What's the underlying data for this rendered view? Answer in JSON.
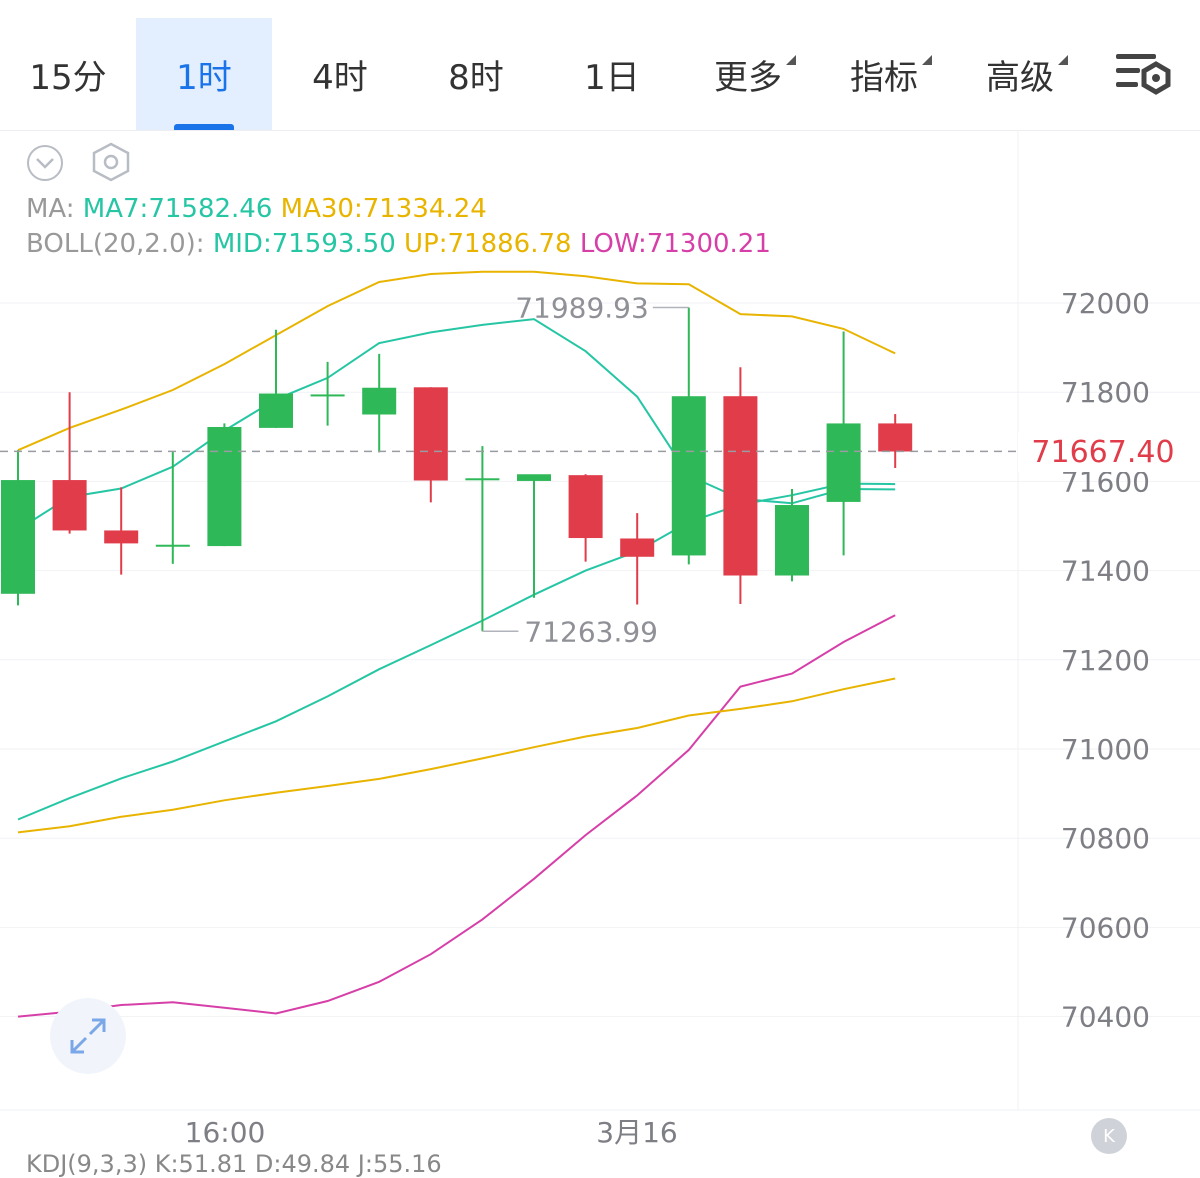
{
  "tabs": [
    {
      "label": "15分",
      "active": false,
      "dropdown": false
    },
    {
      "label": "1时",
      "active": true,
      "dropdown": false
    },
    {
      "label": "4时",
      "active": false,
      "dropdown": false
    },
    {
      "label": "8时",
      "active": false,
      "dropdown": false
    },
    {
      "label": "1日",
      "active": false,
      "dropdown": false
    },
    {
      "label": "更多",
      "active": false,
      "dropdown": true
    },
    {
      "label": "指标",
      "active": false,
      "dropdown": true
    },
    {
      "label": "高级",
      "active": false,
      "dropdown": true
    }
  ],
  "icons": {
    "settings": "chart-settings-icon",
    "collapse_toggle": "chevron-down-circle-icon",
    "indicator_settings": "hexagon-settings-icon",
    "expand": "expand-arrows-icon",
    "side_collapse": "collapse-k-icon"
  },
  "legend": {
    "ma_prefix": "MA:",
    "ma7": "MA7:71582.46",
    "ma30": "MA30:71334.24",
    "boll_prefix": "BOLL(20,2.0):",
    "mid": "MID:71593.50",
    "up": "UP:71886.78",
    "low": "LOW:71300.21"
  },
  "colors": {
    "up": "#2eb857",
    "down": "#e03c4a",
    "ma7": "#26c6a5",
    "ma30": "#e8b400",
    "boll_up": "#e8b400",
    "boll_mid": "#26c6a5",
    "boll_low": "#d63fa8",
    "accent": "#1a73e8"
  },
  "current_price": "71667.40",
  "high_marker": "71989.93",
  "low_marker": "71263.99",
  "kdj_text": "KDJ(9,3,3)  K:51.81  D:49.84  J:55.16",
  "collapse_glyph": "K",
  "chart_data": {
    "type": "candlestick",
    "y_ticks": [
      "72000",
      "71800",
      "71600",
      "71400",
      "71200",
      "71000",
      "70800",
      "70600",
      "70400"
    ],
    "x_ticks": [
      "16:00",
      "3月16"
    ],
    "candles": [
      {
        "o": 71348,
        "h": 71670,
        "l": 71322,
        "c": 71603
      },
      {
        "o": 71603,
        "h": 71800,
        "l": 71483,
        "c": 71490
      },
      {
        "o": 71490,
        "h": 71587,
        "l": 71391,
        "c": 71461
      },
      {
        "o": 71458,
        "h": 71668,
        "l": 71415,
        "c": 71458
      },
      {
        "o": 71455,
        "h": 71730,
        "l": 71455,
        "c": 71722
      },
      {
        "o": 71720,
        "h": 71940,
        "l": 71720,
        "c": 71797
      },
      {
        "o": 71795,
        "h": 71868,
        "l": 71725,
        "c": 71795
      },
      {
        "o": 71750,
        "h": 71886,
        "l": 71665,
        "c": 71810
      },
      {
        "o": 71811,
        "h": 71811,
        "l": 71553,
        "c": 71602
      },
      {
        "o": 71607,
        "h": 71679,
        "l": 71264,
        "c": 71607
      },
      {
        "o": 71601,
        "h": 71611,
        "l": 71339,
        "c": 71616
      },
      {
        "o": 71614,
        "h": 71616,
        "l": 71420,
        "c": 71473
      },
      {
        "o": 71472,
        "h": 71529,
        "l": 71324,
        "c": 71431
      },
      {
        "o": 71434,
        "h": 71990,
        "l": 71414,
        "c": 71791
      },
      {
        "o": 71791,
        "h": 71856,
        "l": 71325,
        "c": 71389
      },
      {
        "o": 71389,
        "h": 71583,
        "l": 71376,
        "c": 71547
      },
      {
        "o": 71554,
        "h": 71936,
        "l": 71434,
        "c": 71730
      },
      {
        "o": 71730,
        "h": 71751,
        "l": 71630,
        "c": 71667
      }
    ],
    "boll_up": [
      71670,
      71720,
      71761,
      71805,
      71863,
      71928,
      71993,
      72047,
      72065,
      72070,
      72070,
      72060,
      72044,
      72042,
      71975,
      71970,
      71942,
      71887
    ],
    "boll_mid": [
      70842,
      70890,
      70934,
      70972,
      71017,
      71062,
      71118,
      71179,
      71233,
      71288,
      71346,
      71400,
      71443,
      71509,
      71548,
      71569,
      71595,
      71594
    ],
    "boll_low": [
      70400,
      70411,
      70426,
      70432,
      70420,
      70407,
      70435,
      70478,
      70540,
      70618,
      70709,
      70807,
      70896,
      70998,
      71140,
      71169,
      71240,
      71300
    ],
    "ma7": [
      71492,
      71565,
      71584,
      71633,
      71714,
      71784,
      71832,
      71910,
      71934,
      71951,
      71964,
      71892,
      71790,
      71613,
      71561,
      71551,
      71583,
      71582
    ],
    "ma30": [
      70813,
      70827,
      70848,
      70864,
      70885,
      70902,
      70917,
      70933,
      70955,
      70979,
      71004,
      71028,
      71047,
      71075,
      71090,
      71107,
      71134,
      71158
    ]
  }
}
